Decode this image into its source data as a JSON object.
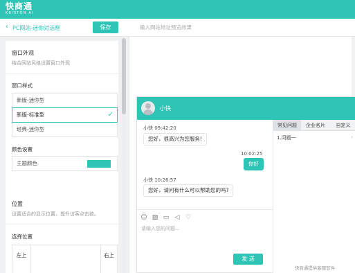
{
  "brand": {
    "name": "快商通",
    "sub": "KRISTON AI"
  },
  "colors": {
    "accent": "#2ec4b6",
    "panel_bg": "#f0f1f3"
  },
  "left_panel": {
    "back_icon": "chevron-left-icon",
    "title": "PC网站-迷你对话框",
    "save_label": "保存",
    "appearance": {
      "title": "窗口外观",
      "desc": "结合网站风格设置窗口外观",
      "style_label": "窗口样式",
      "options": [
        "新版-迷你型",
        "新版-标准型",
        "经典-迷你型"
      ],
      "selected_index": 1,
      "color_label": "颜色设置",
      "theme_color_label": "主题颜色",
      "theme_color": "#2ec4b6"
    },
    "position": {
      "title": "位置",
      "desc": "设置适合的显示位置，提升访客点击欲。",
      "select_label": "选择位置",
      "top_left": "左上",
      "top_right": "右上"
    }
  },
  "preview": {
    "url_placeholder": "输入网站地址预览效果",
    "chat": {
      "agent_name": "小快",
      "messages": [
        {
          "from": "agent",
          "meta": "小快 09:42:20",
          "text": "您好，很高兴为您服务!"
        },
        {
          "from": "me",
          "meta": "10:02:25",
          "text": "你好"
        },
        {
          "from": "agent",
          "meta": "小快 10:26:57",
          "text": "您好，请问有什么可以帮助您的吗?"
        }
      ],
      "toolbar_icons": [
        "emoji-icon",
        "image-icon",
        "file-icon",
        "voice-icon",
        "thumbs-up-icon"
      ],
      "input_placeholder": "请输入您的问题...",
      "send_label": "发 送",
      "tabs": [
        "常见问题",
        "企业名片",
        "自定义"
      ],
      "active_tab": 0,
      "faq_items": [
        "1.问题一"
      ],
      "footer": "快商通提供客服软件"
    }
  }
}
